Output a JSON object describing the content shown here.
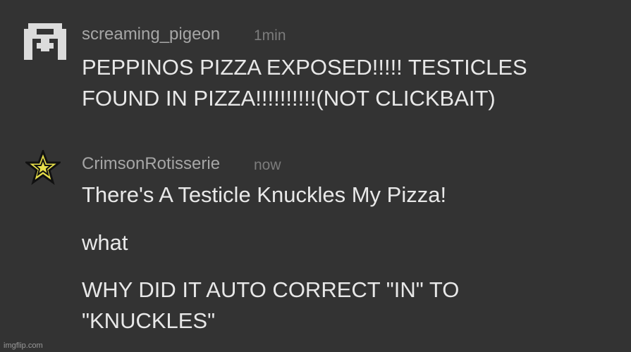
{
  "messages": [
    {
      "username": "scream­ing_pigeon",
      "time": "1min",
      "avatar_icon": "pixel-pigeon-icon",
      "lines": [
        "PEPPINOS PIZZA EXPOSED!!!!! TESTICLES",
        "FOUND IN PIZZA!!!!!!!!!!(NOT CLICKBAIT)"
      ]
    },
    {
      "username": "CrimsonRotisserie",
      "time": "now",
      "avatar_icon": "star-icon",
      "lines": [
        "There's A Testicle Knuckles My Pizza!",
        "what",
        "WHY DID IT AUTO CORRECT \"IN\" TO",
        "\"KNUCKLES\""
      ]
    }
  ],
  "watermark": "imgflip.com",
  "colors": {
    "background": "#333333",
    "username": "#a6a6a6",
    "timestamp": "#7c7c7c",
    "message_text": "#e8e8e8",
    "star_fill": "#e8e04a"
  }
}
